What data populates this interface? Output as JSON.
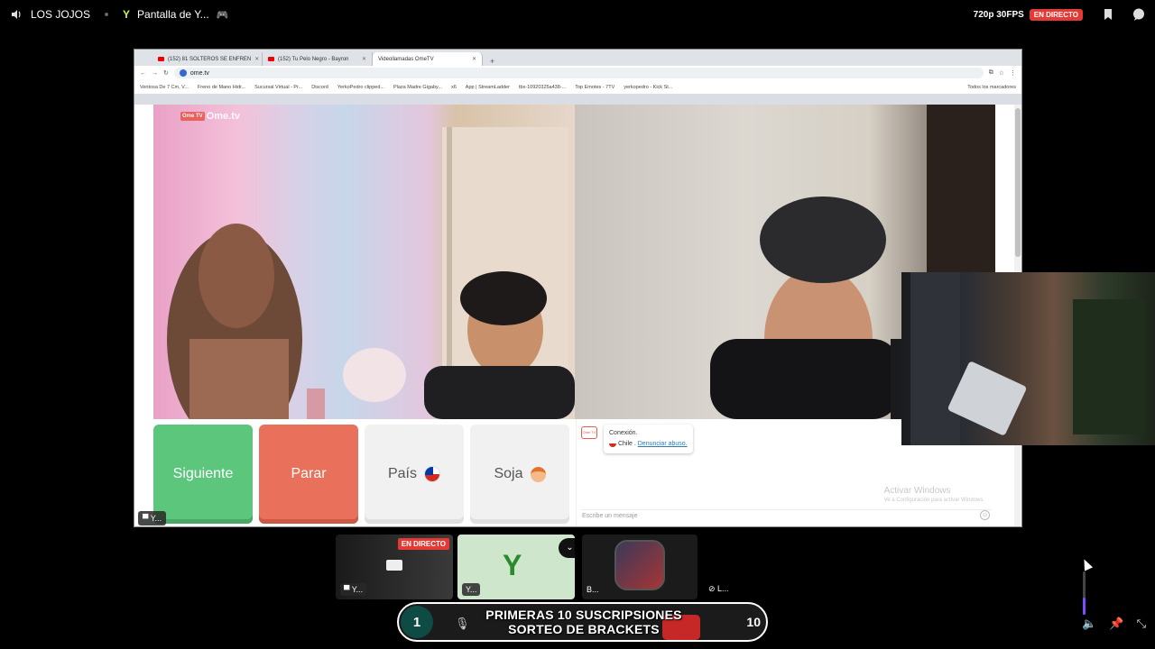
{
  "topbar": {
    "server_name": "LOS JOJOS",
    "stream_title": "Pantalla de Y...",
    "quality": "720p 30FPS",
    "live_badge": "EN DIRECTO"
  },
  "browser": {
    "tabs": [
      {
        "label": "(152) 81 SOLTEROS SE ENFREN",
        "active": false
      },
      {
        "label": "(152) Tu Pelo Negro - Bayron",
        "active": false
      },
      {
        "label": "Videollamadas OmeTV",
        "active": true
      }
    ],
    "url": "ome.tv",
    "bookmarks": [
      "Ventosa De 7 Cm, V...",
      "Freno de Mano Hidr...",
      "Sucursal Virtual - Pr...",
      "Discord",
      "YerkoPedro clipped...",
      "Plaza Madre Gigaby...",
      "x6",
      "App | StreamLadder",
      "tbx-10920325a438-...",
      "Top Emotes - 7TV",
      "yerkopedro - Kick St...",
      "Todos los marcadores"
    ]
  },
  "ometv": {
    "logo": "Ome.tv",
    "logo_badge": "Ome TV",
    "buttons": {
      "next": "Siguiente",
      "stop": "Parar",
      "country": "País",
      "gender": "Soja"
    },
    "chat": {
      "connection_label": "Conexión.",
      "country": "Chile",
      "report_link": "Denunciar abuso.",
      "input_placeholder": "Escribe un mensaje",
      "watermark_title": "Activar Windows",
      "watermark_sub": "Ve a Configuración para activar Windows."
    },
    "sharer_label": "Y..."
  },
  "participants": [
    {
      "label": "Y...",
      "live": "EN DIRECTO"
    },
    {
      "label": "Y..."
    },
    {
      "label": "B..."
    },
    {
      "label": "L..."
    }
  ],
  "controlbar": {
    "left_count": "1",
    "banner_line1": "PRIMERAS 10 SUSCRIPSIONES",
    "banner_line2": "SORTEO DE BRACKETS",
    "right_count": "10"
  },
  "volume_level": 0.4,
  "colors": {
    "live_red": "#e53935",
    "ome_next_green": "#5cc67d",
    "ome_stop_red": "#e9705a",
    "brand_lime": "#c5f73f",
    "bar_teal": "#0f4b45"
  }
}
